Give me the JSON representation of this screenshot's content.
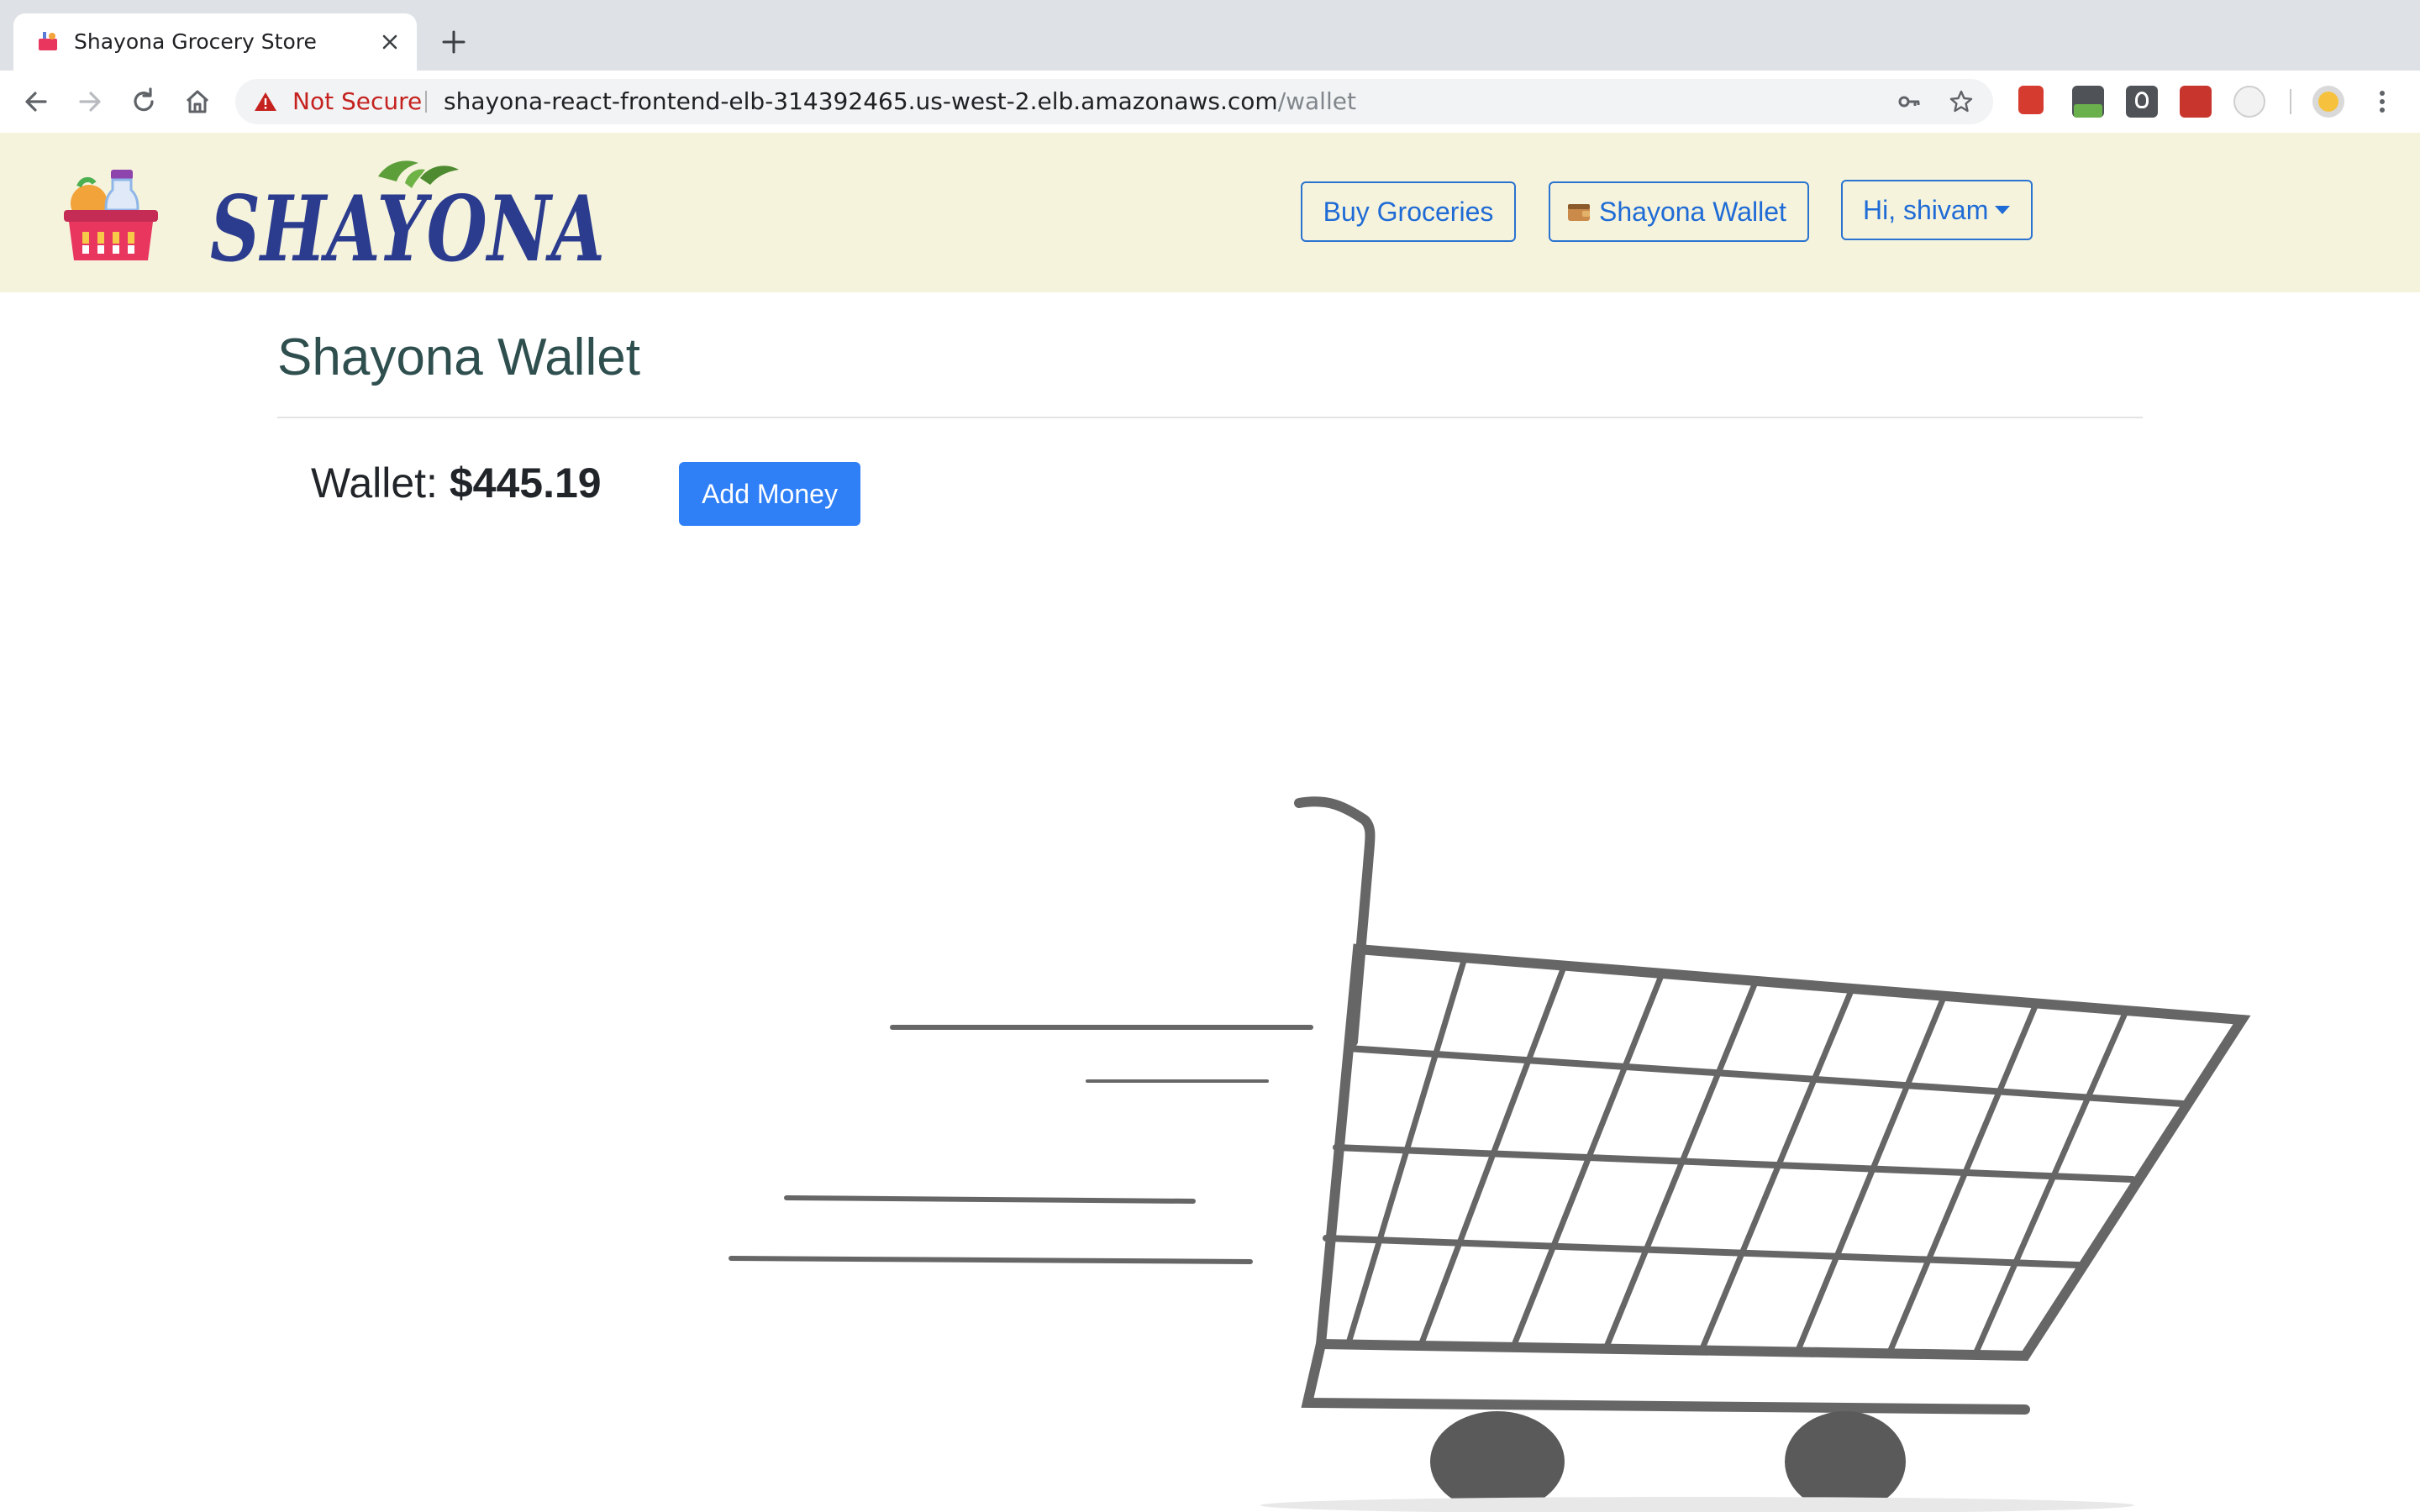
{
  "browser": {
    "tab_title": "Shayona Grocery Store",
    "security_label": "Not Secure",
    "url_host": "shayona-react-frontend-elb-314392465.us-west-2.elb.amazonaws.com",
    "url_path": "/wallet"
  },
  "header": {
    "brand": "SHAYONA",
    "nav": {
      "buy_groceries": "Buy Groceries",
      "wallet": "Shayona Wallet",
      "user_menu": "Hi, shivam"
    }
  },
  "main": {
    "title": "Shayona Wallet",
    "wallet_label": "Wallet:",
    "wallet_amount": "$445.19",
    "add_money": "Add Money"
  },
  "colors": {
    "header_bg": "#f5f3dc",
    "primary": "#2f7ff7",
    "brand_navy": "#2b3c8f",
    "basket": "#e8365f"
  },
  "icons": [
    "basket-favicon-icon",
    "close-icon",
    "plus-icon",
    "back-icon",
    "forward-icon",
    "reload-icon",
    "home-icon",
    "warning-icon",
    "key-icon",
    "star-icon",
    "wallet-icon",
    "shopping-cart-illustration"
  ]
}
